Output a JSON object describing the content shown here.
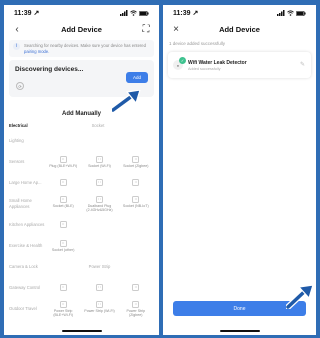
{
  "left": {
    "status": {
      "time": "11:39",
      "signal": "↗"
    },
    "nav": {
      "back": "‹",
      "title": "Add Device",
      "scan": "⛶"
    },
    "notice": {
      "text": "Searching for nearby devices. Make sure your device has entered",
      "link": "pairing mode."
    },
    "discover": {
      "label": "Discovering devices...",
      "add_label": "Add"
    },
    "manual_title": "Add Manually",
    "grid_header": {
      "category": "Electrical",
      "sub": "Socket"
    },
    "rows": [
      {
        "cat": "Lighting",
        "cells": []
      },
      {
        "cat": "Sensors",
        "cells": [
          {
            "name": "Plug (BLE+Wi-Fi)"
          },
          {
            "name": "Socket (Wi-Fi)"
          },
          {
            "name": "Socket (Zigbee)"
          }
        ]
      },
      {
        "cat": "Large Home Ap...",
        "cells": [
          {
            "name": ""
          },
          {
            "name": ""
          },
          {
            "name": ""
          }
        ]
      },
      {
        "cat": "Small Home Appliances",
        "cells": [
          {
            "name": "Socket (BLE)"
          },
          {
            "name": "Dualband Plug (2.4GHz&5GHz)"
          },
          {
            "name": "Socket (NB-IoT)"
          }
        ]
      },
      {
        "cat": "Kitchen Appliances",
        "cells": [
          {
            "name": ""
          }
        ]
      },
      {
        "cat": "Exercise & Health",
        "cells": [
          {
            "name": "Socket (other)"
          }
        ]
      },
      {
        "cat": "Camera & Lock",
        "center_text": "Power Strip"
      },
      {
        "cat": "Gateway Control",
        "cells": [
          {
            "name": ""
          },
          {
            "name": ""
          },
          {
            "name": ""
          }
        ]
      },
      {
        "cat": "Outdoor Travel",
        "cells": [
          {
            "name": "Power Strip (BLE+Wi-Fi)"
          },
          {
            "name": "Power Strip (Wi-Fi)"
          },
          {
            "name": "Power Strip (Zigbee)"
          }
        ]
      }
    ]
  },
  "right": {
    "status": {
      "time": "11:39",
      "signal": "↗"
    },
    "nav": {
      "close": "×",
      "title": "Add Device"
    },
    "added_text": "1 device added successfully",
    "device": {
      "name": "Wifi Water Leak Detector",
      "status": "Added successfully"
    },
    "done_label": "Done"
  },
  "colors": {
    "frame": "#2f6db5",
    "accent": "#3d7ee8",
    "success": "#3ec28f",
    "arrow": "#1f5aa8"
  }
}
